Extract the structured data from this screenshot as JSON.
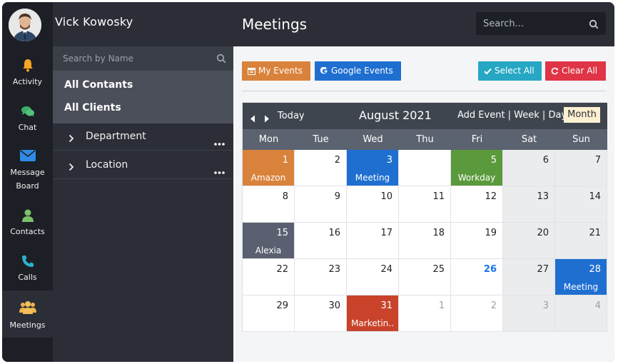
{
  "user": {
    "name": "Vick Kowosky"
  },
  "rail": [
    {
      "label": "Activity",
      "icon": "bell-icon"
    },
    {
      "label": "Chat",
      "icon": "chat-icon"
    },
    {
      "label_line1": "Message",
      "label_line2": "Board",
      "icon": "envelope-icon"
    },
    {
      "label": "Contacts",
      "icon": "user-icon"
    },
    {
      "label": "Calls",
      "icon": "phone-icon"
    },
    {
      "label": "Meetings",
      "icon": "group-icon",
      "active": true
    }
  ],
  "panel": {
    "search_placeholder": "Search by Name",
    "groups": [
      "All Contants",
      "All Clients"
    ],
    "tree": [
      "Department",
      "Location"
    ]
  },
  "header": {
    "title": "Meetings",
    "search_placeholder": "Search..."
  },
  "toolbar": {
    "my_events": "My Events",
    "google_events": "Google Events",
    "select_all": "Select All",
    "clear_all": "Clear All"
  },
  "calendar": {
    "today": "Today",
    "month": "August 2021",
    "views": "Add Event | Week | Day",
    "month_view": "Month",
    "days": [
      "Mon",
      "Tue",
      "Wed",
      "Thu",
      "Fri",
      "Sat",
      "Sun"
    ],
    "weeks": [
      [
        {
          "d": "1",
          "ev": "Amazon",
          "color": "#d9823b"
        },
        {
          "d": "2"
        },
        {
          "d": "3",
          "ev": "Meeting",
          "color": "#1f6fd1"
        },
        {
          "d": ""
        },
        {
          "d": "5",
          "ev": "Workday",
          "color": "#5b9a3c"
        },
        {
          "d": "6"
        },
        {
          "d": "7"
        }
      ],
      [
        {
          "d": "8"
        },
        {
          "d": "9"
        },
        {
          "d": "10"
        },
        {
          "d": "11"
        },
        {
          "d": "12"
        },
        {
          "d": "13"
        },
        {
          "d": "14"
        }
      ],
      [
        {
          "d": "15",
          "ev": "Alexia",
          "color": "#5a6070"
        },
        {
          "d": "16"
        },
        {
          "d": "17"
        },
        {
          "d": "18"
        },
        {
          "d": "19"
        },
        {
          "d": "20"
        },
        {
          "d": "21"
        }
      ],
      [
        {
          "d": "22"
        },
        {
          "d": "23"
        },
        {
          "d": "24"
        },
        {
          "d": "25"
        },
        {
          "d": "26",
          "today": true
        },
        {
          "d": "27"
        },
        {
          "d": "28",
          "ev": "Meeting",
          "color": "#1f6fd1"
        }
      ],
      [
        {
          "d": "29"
        },
        {
          "d": "30"
        },
        {
          "d": "31",
          "ev": "Marketin..",
          "color": "#c9432b"
        },
        {
          "d": "1",
          "other": true
        },
        {
          "d": "2",
          "other": true
        },
        {
          "d": "3",
          "other": true
        },
        {
          "d": "4",
          "other": true
        }
      ]
    ]
  },
  "colors": {
    "my_events": "#d9823b",
    "google_events": "#1f6fd1",
    "select_all": "#26a7c4",
    "clear_all": "#e03546"
  }
}
